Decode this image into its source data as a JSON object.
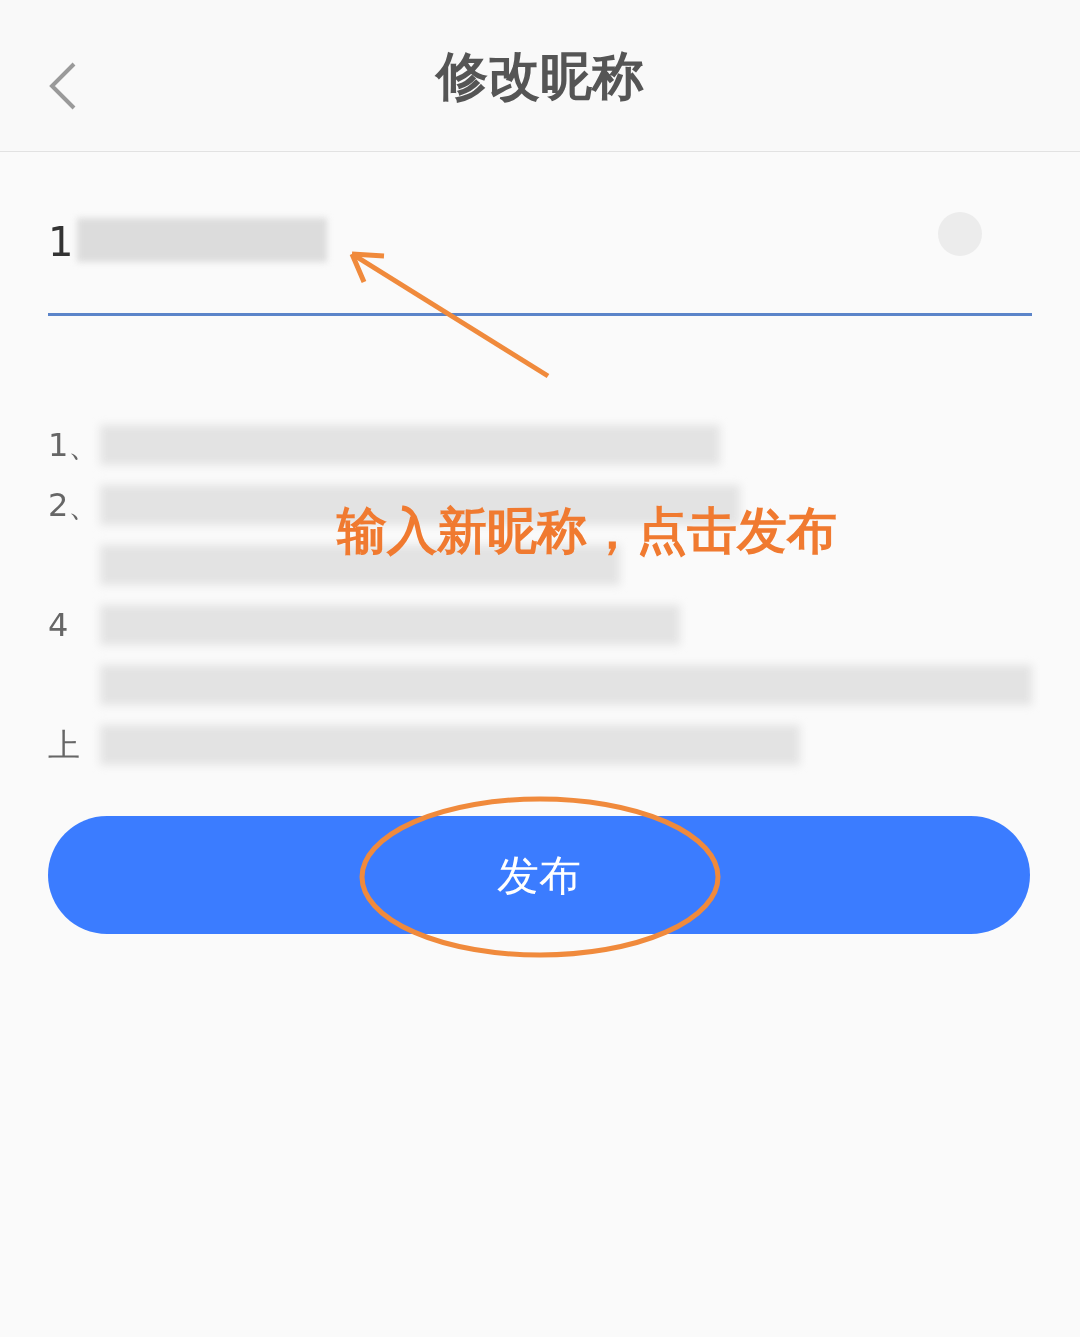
{
  "header": {
    "title": "修改昵称"
  },
  "nickname_field": {
    "value": "1"
  },
  "tips": [
    {
      "kind": "numbered",
      "prefix": "1、"
    },
    {
      "kind": "numbered",
      "prefix": "2、"
    },
    {
      "kind": "blurred"
    },
    {
      "kind": "numbered",
      "prefix": "4"
    },
    {
      "kind": "blurred"
    },
    {
      "kind": "numbered",
      "prefix": "上"
    }
  ],
  "annotation": {
    "text": "输入新昵称，点击发布"
  },
  "publish_button": {
    "label": "发布"
  }
}
